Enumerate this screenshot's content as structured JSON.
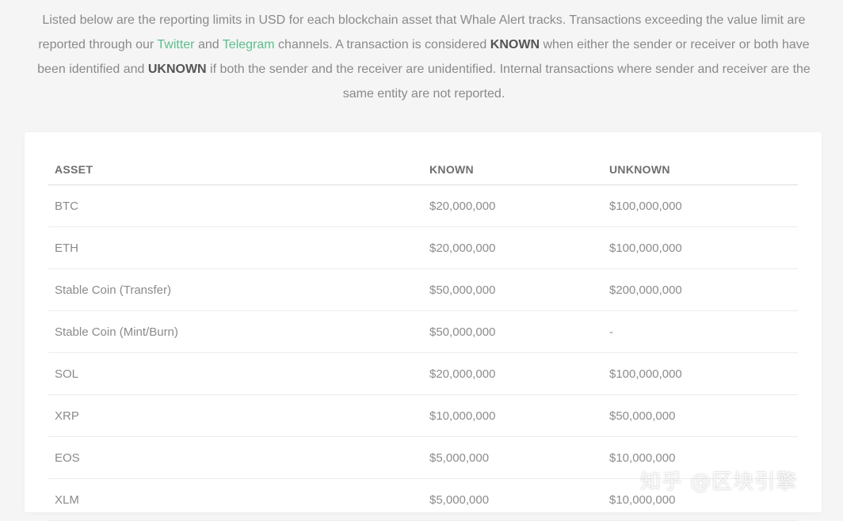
{
  "intro": {
    "part1": "Listed below are the reporting limits in USD for each blockchain asset that Whale Alert tracks. Transactions exceeding the value limit are reported through our ",
    "twitter_link": "Twitter",
    "and_text": " and ",
    "telegram_link": "Telegram",
    "part2": " channels. A transaction is considered ",
    "known_bold": "KNOWN",
    "part3": " when either the sender or receiver or both have been identified and ",
    "unknown_bold": "UKNOWN",
    "part4": " if both the sender and the receiver are unidentified. Internal transactions where sender and receiver are the same entity are not reported."
  },
  "table": {
    "headers": {
      "asset": "ASSET",
      "known": "KNOWN",
      "unknown": "UNKNOWN"
    },
    "rows": [
      {
        "asset": "BTC",
        "known": "$20,000,000",
        "unknown": "$100,000,000"
      },
      {
        "asset": "ETH",
        "known": "$20,000,000",
        "unknown": "$100,000,000"
      },
      {
        "asset": "Stable Coin (Transfer)",
        "known": "$50,000,000",
        "unknown": "$200,000,000"
      },
      {
        "asset": "Stable Coin (Mint/Burn)",
        "known": "$50,000,000",
        "unknown": "-"
      },
      {
        "asset": "SOL",
        "known": "$20,000,000",
        "unknown": "$100,000,000"
      },
      {
        "asset": "XRP",
        "known": "$10,000,000",
        "unknown": "$50,000,000"
      },
      {
        "asset": "EOS",
        "known": "$5,000,000",
        "unknown": "$10,000,000"
      },
      {
        "asset": "XLM",
        "known": "$5,000,000",
        "unknown": "$10,000,000"
      }
    ]
  },
  "watermark": "知乎 @区块引擎",
  "colors": {
    "link": "#5bbf8a",
    "background": "#f5f5f5",
    "card": "#ffffff"
  }
}
